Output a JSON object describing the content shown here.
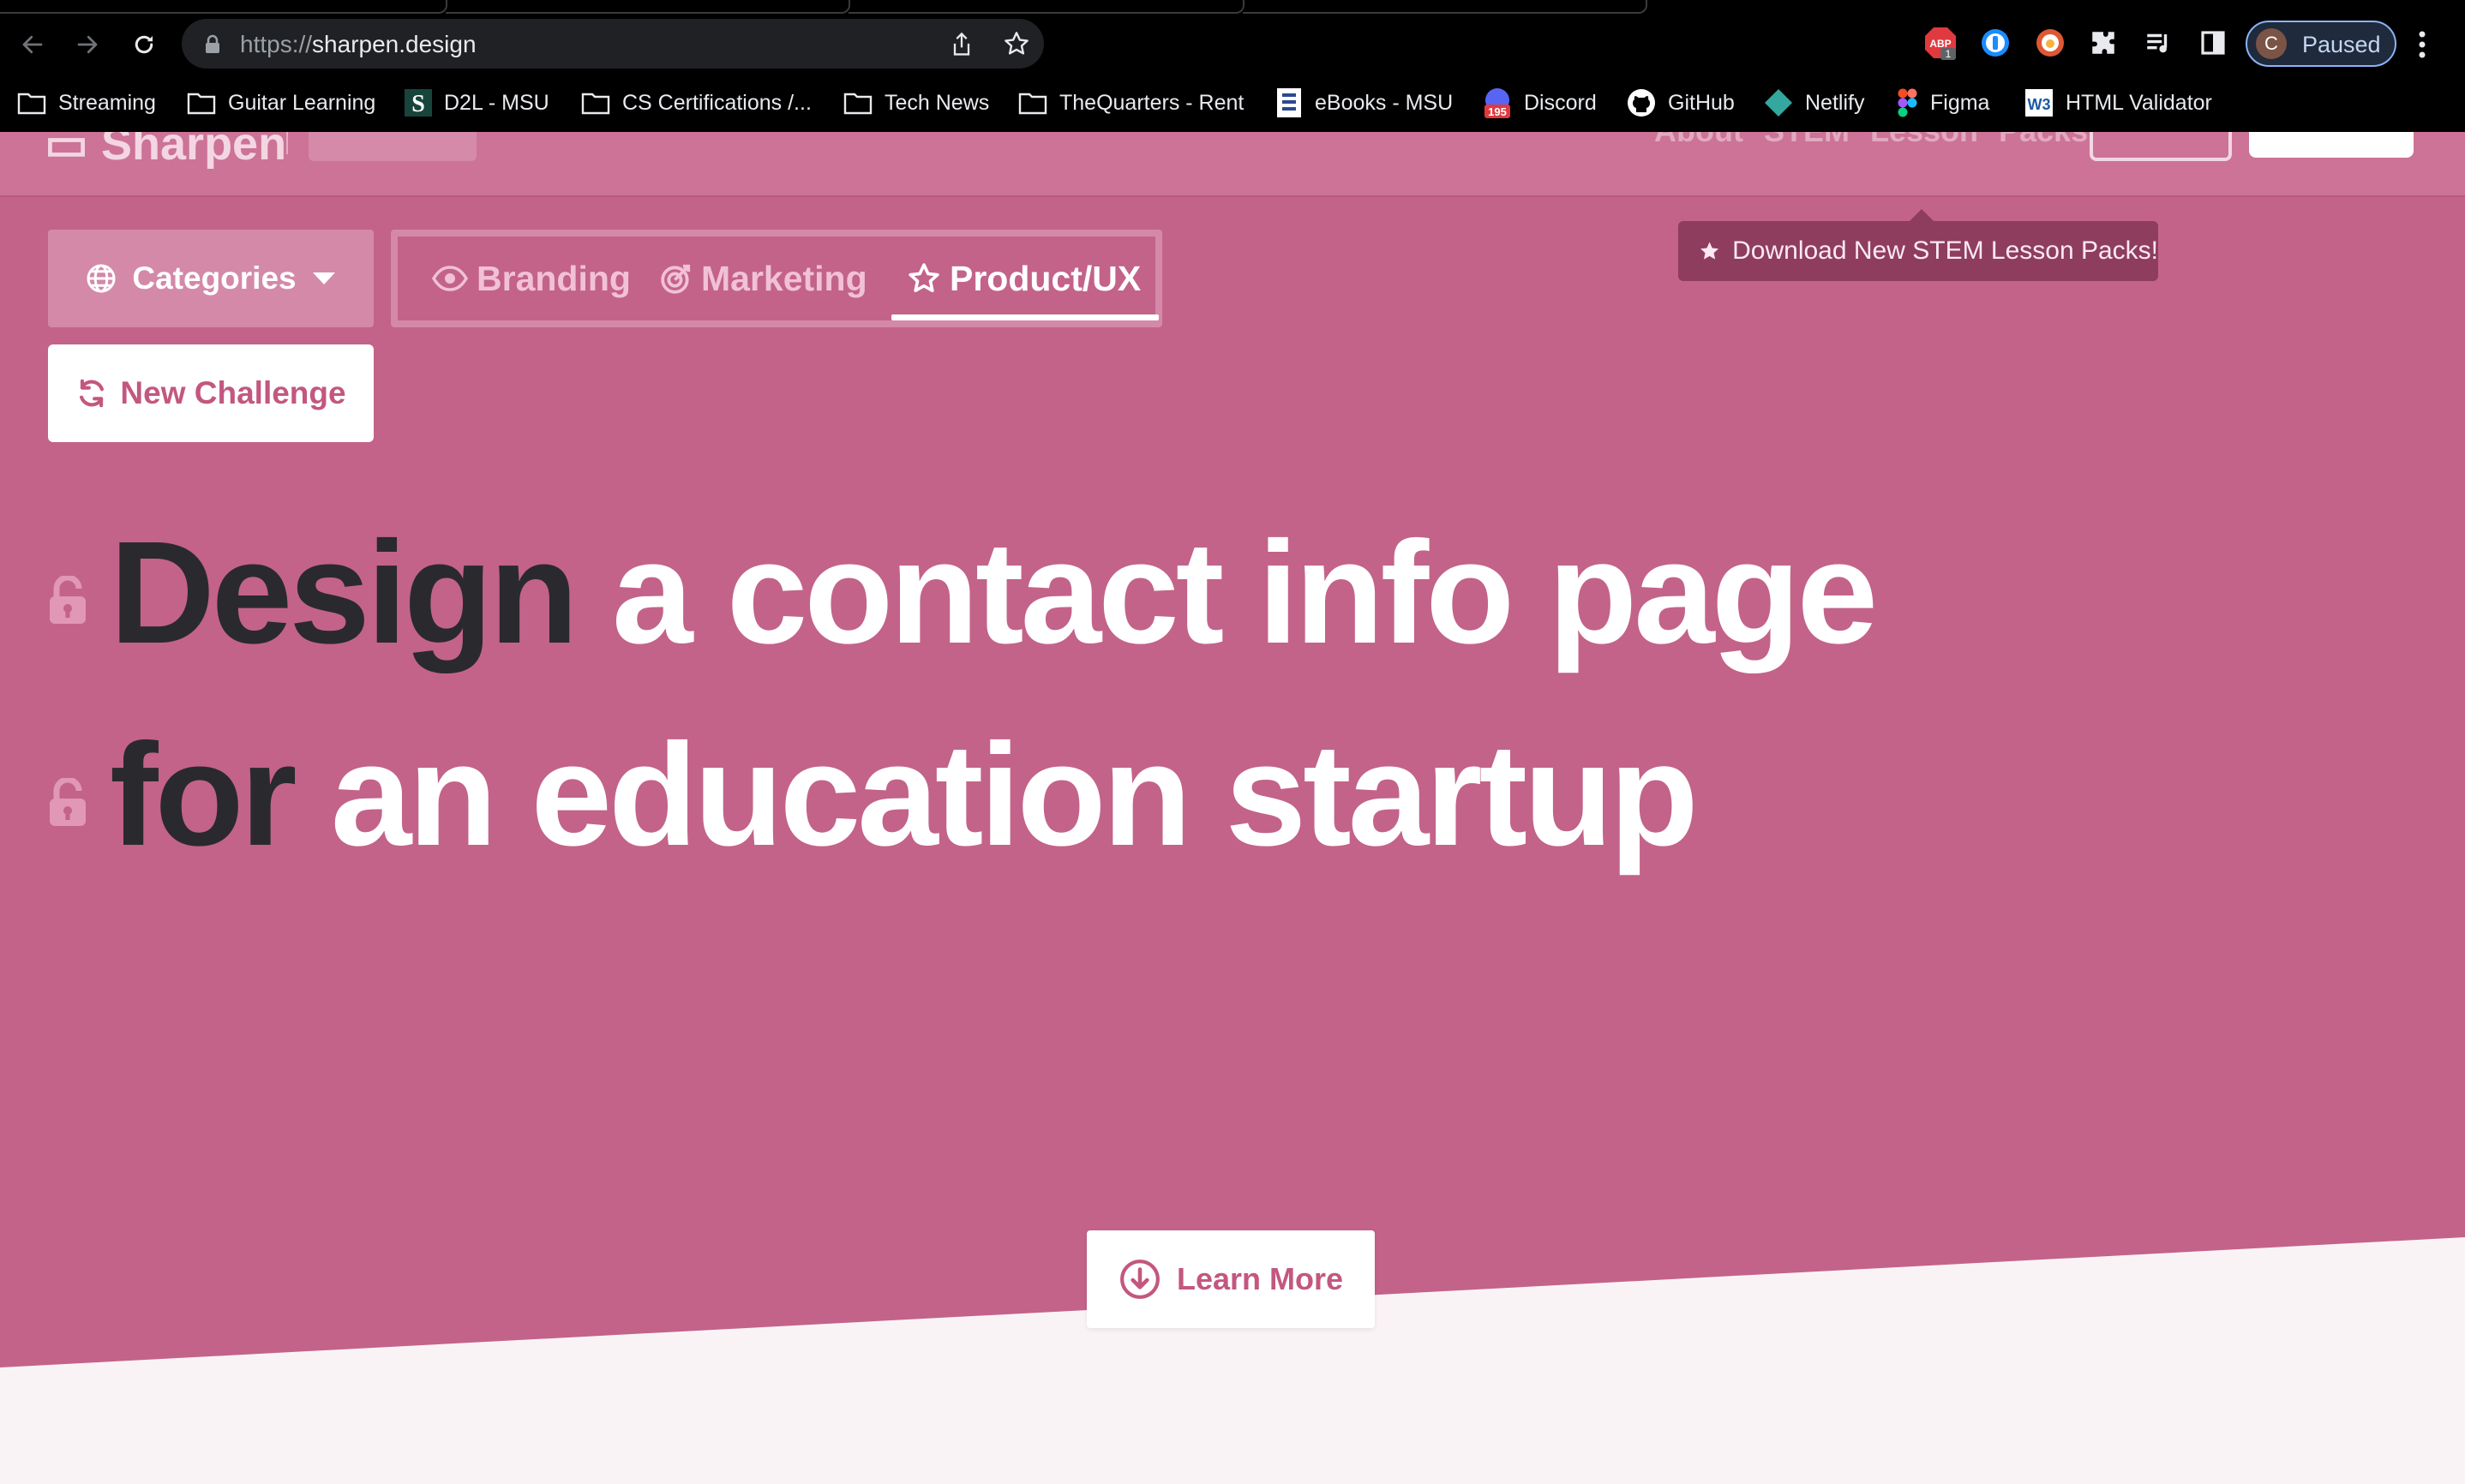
{
  "browser": {
    "url_scheme": "https://",
    "url_host": "sharpen.design",
    "profile_initial": "C",
    "profile_status": "Paused",
    "extensions": [
      "abp-icon",
      "1password-icon",
      "duckduckgo-icon",
      "puzzle-icon",
      "media-icon",
      "sidepanel-icon"
    ],
    "abp_badge": "1",
    "bookmarks": [
      {
        "label": "Streaming",
        "icon": "folder-icon"
      },
      {
        "label": "Guitar Learning",
        "icon": "folder-icon"
      },
      {
        "label": "D2L - MSU",
        "icon": "d2l-icon"
      },
      {
        "label": "CS Certifications /...",
        "icon": "folder-icon"
      },
      {
        "label": "Tech News",
        "icon": "folder-icon"
      },
      {
        "label": "TheQuarters - Rent",
        "icon": "folder-icon"
      },
      {
        "label": "eBooks - MSU",
        "icon": "ebooks-icon"
      },
      {
        "label": "Discord",
        "icon": "discord-icon"
      },
      {
        "label": "GitHub",
        "icon": "github-icon"
      },
      {
        "label": "Netlify",
        "icon": "netlify-icon"
      },
      {
        "label": "Figma",
        "icon": "figma-icon"
      },
      {
        "label": "HTML Validator",
        "icon": "w3c-icon"
      }
    ],
    "discord_badge": "195"
  },
  "site": {
    "tooltip": "Download New STEM Lesson Packs!",
    "categories_label": "Categories",
    "tabs": [
      {
        "label": "Branding",
        "icon": "eye-icon",
        "active": false
      },
      {
        "label": "Marketing",
        "icon": "target-icon",
        "active": false
      },
      {
        "label": "Product/UX",
        "icon": "star-outline-icon",
        "active": true
      }
    ],
    "new_challenge_label": "New Challenge",
    "headline": {
      "line1_dark": "Design",
      "line1_light": "a contact info page",
      "line2_dark": "for",
      "line2_light": "an education startup"
    },
    "learn_more_label": "Learn More"
  },
  "colors": {
    "page_bg": "#c36389",
    "accent": "#c3577f",
    "dark_word": "#2a2a2e",
    "tooltip_bg": "#8e3d5f"
  }
}
